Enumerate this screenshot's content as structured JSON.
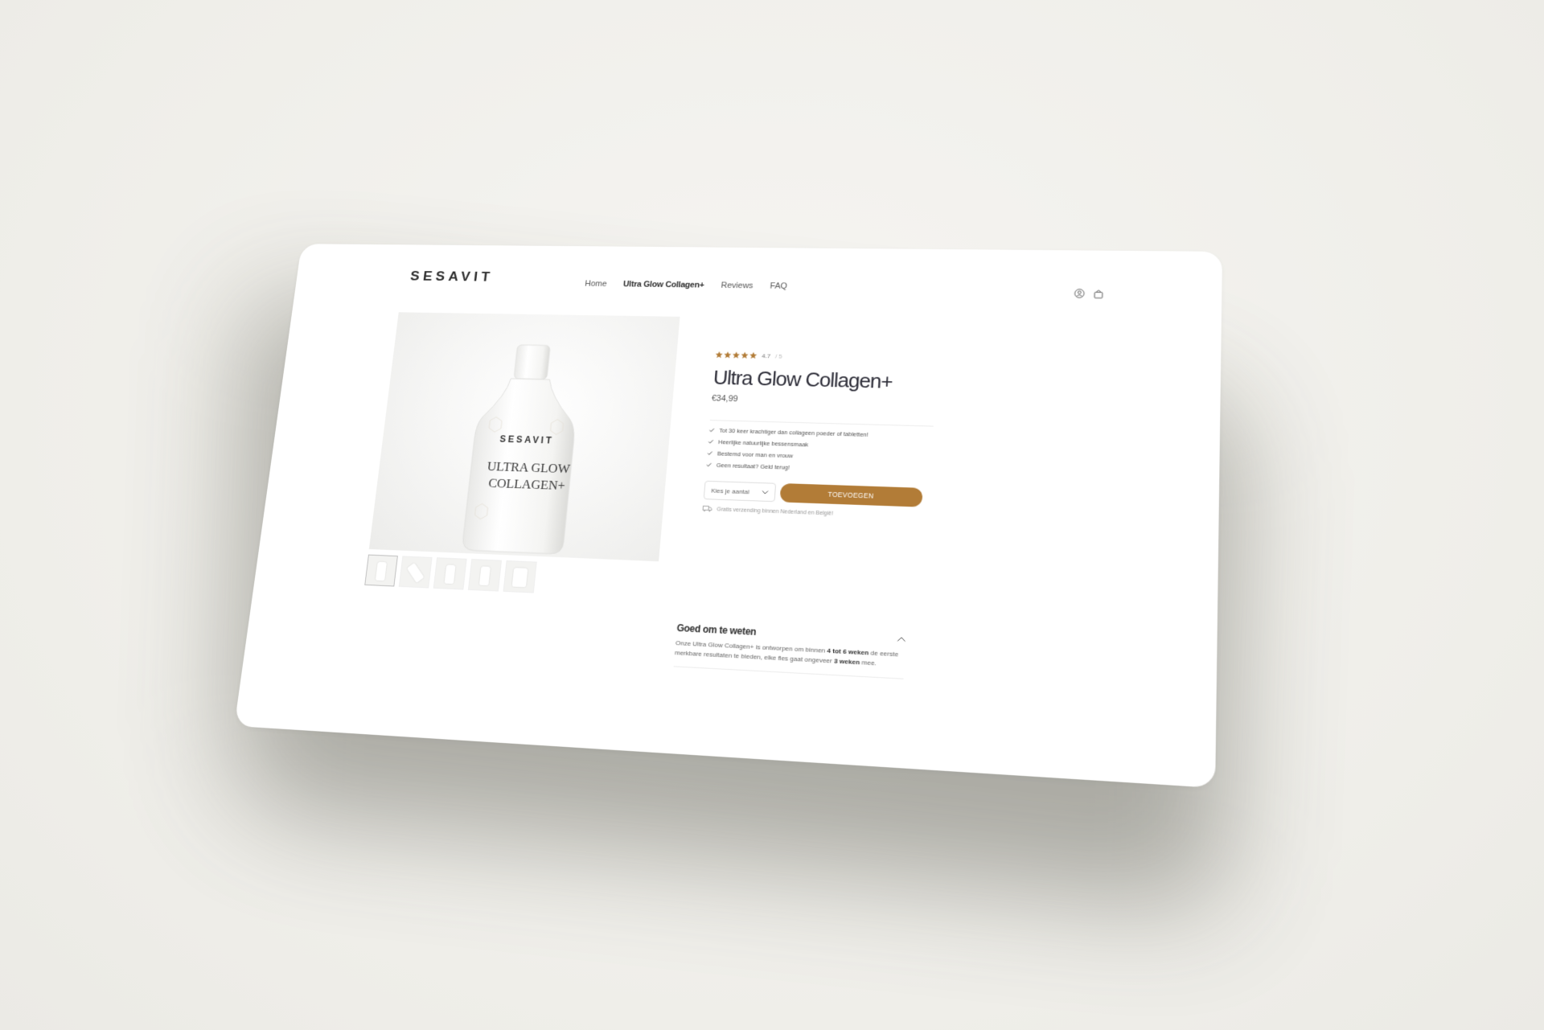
{
  "brand": {
    "logo": "SESAVIT"
  },
  "nav": {
    "items": [
      {
        "label": "Home",
        "active": false
      },
      {
        "label": "Ultra Glow Collagen+",
        "active": true
      },
      {
        "label": "Reviews",
        "active": false
      },
      {
        "label": "FAQ",
        "active": false
      }
    ]
  },
  "header_icons": [
    "account-icon",
    "bag-icon"
  ],
  "product": {
    "bottle_brand": "SESAVIT",
    "bottle_title_line1": "ULTRA GLOW",
    "bottle_title_line2": "COLLAGEN+",
    "rating": {
      "score": "4.7",
      "max": "/ 5",
      "stars": 5
    },
    "name": "Ultra Glow Collagen+",
    "price": "€34,99",
    "benefits": [
      "Tot 30 keer krachtiger dan collageen poeder of tabletten!",
      "Heerlijke natuurlijke bessensmaak",
      "Bestemd voor man en vrouw",
      "Geen resultaat? Geld terug!"
    ],
    "quantity_placeholder": "Kies je aantal",
    "add_button": "TOEVOEGEN",
    "shipping": "Gratis verzending binnen Nederland en België!",
    "thumbnail_count": 5
  },
  "faq": {
    "title": "Goed om te weten",
    "text_part1": "Onze Ultra Glow Collagen+ is ontworpen om binnen ",
    "text_bold1": "4 tot 6 weken",
    "text_part2": " de eerste merkbare resultaten te bieden, elke fles gaat ongeveer ",
    "text_bold2": "3 weken",
    "text_part3": " mee."
  },
  "colors": {
    "accent": "#b27c37",
    "star": "#b27c37",
    "background": "#f1f0ec"
  }
}
